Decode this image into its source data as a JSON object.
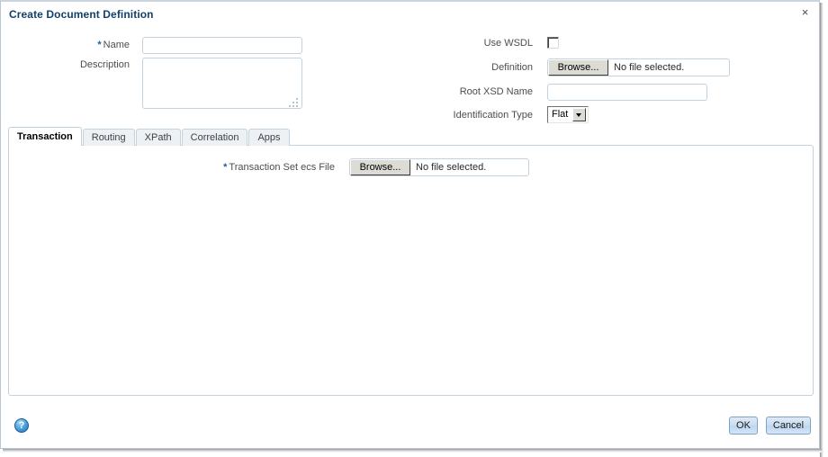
{
  "window": {
    "title": "Create Document Definition",
    "close_label": "×"
  },
  "form": {
    "left": [
      {
        "label": "Name",
        "required": true,
        "type": "text",
        "value": "",
        "placeholder": ""
      },
      {
        "label": "Description",
        "required": false,
        "type": "textarea",
        "value": "",
        "placeholder": ""
      }
    ],
    "right": {
      "use_wsdl_label": "Use WSDL",
      "use_wsdl_checked": false,
      "definition_label": "Definition",
      "definition_browse_label": "Browse...",
      "definition_file_status": "No file selected.",
      "root_xsd_label": "Root XSD Name",
      "root_xsd_value": "",
      "identification_type_label": "Identification Type",
      "identification_type_value": "Flat",
      "identification_type_options": [
        "Flat"
      ]
    }
  },
  "tabs": [
    {
      "label": "Transaction",
      "active": true
    },
    {
      "label": "Routing",
      "active": false
    },
    {
      "label": "XPath",
      "active": false
    },
    {
      "label": "Correlation",
      "active": false
    },
    {
      "label": "Apps",
      "active": false
    }
  ],
  "transaction_tab": {
    "ecs_file_label": "Transaction Set ecs File",
    "ecs_file_required": true,
    "ecs_browse_label": "Browse...",
    "ecs_file_status": "No file selected."
  },
  "footer": {
    "help_glyph": "?",
    "ok_label": "OK",
    "cancel_label": "Cancel"
  },
  "colors": {
    "title": "#11406a",
    "required_star": "#22609c",
    "field_border": "#c3d2dc",
    "button_accent": "#7ba2c9"
  }
}
